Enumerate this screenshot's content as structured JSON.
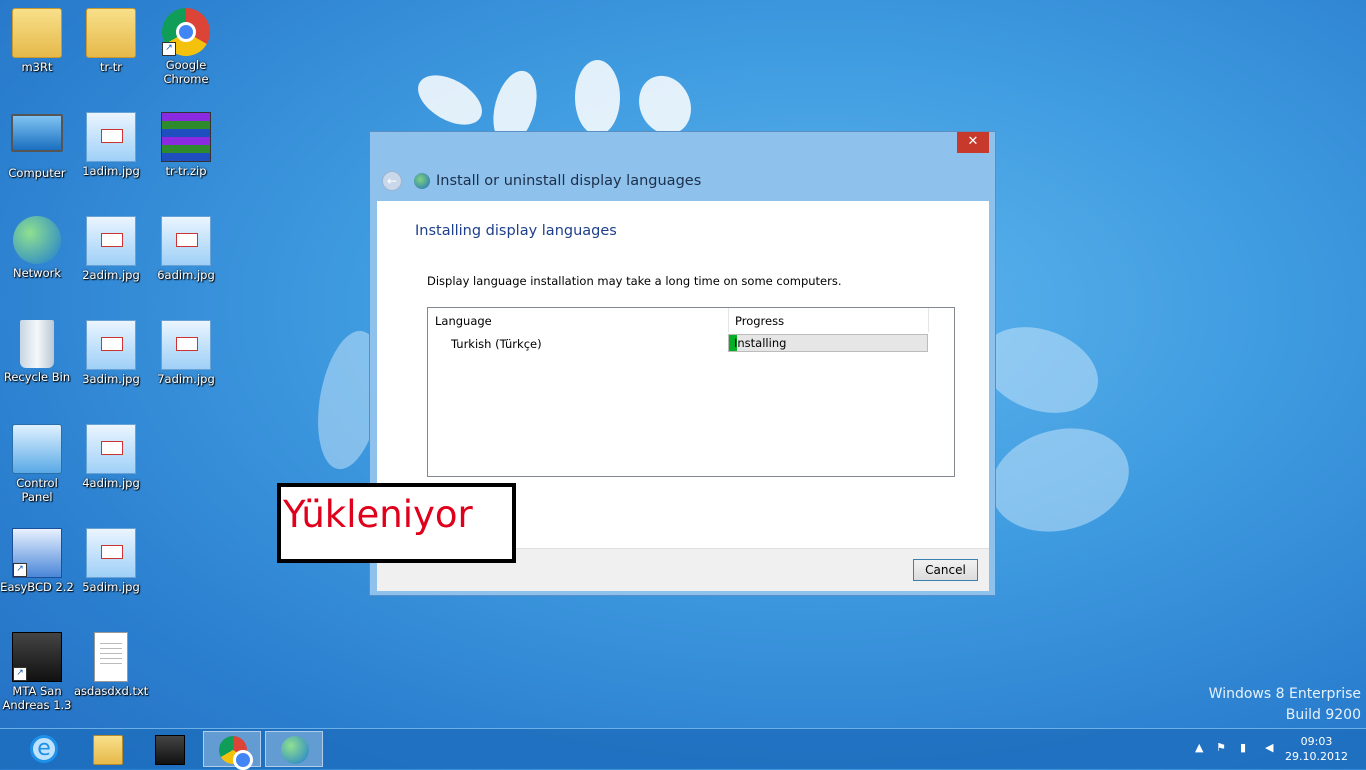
{
  "desktop": {
    "icons": [
      {
        "label": "m3Rt"
      },
      {
        "label": "tr-tr"
      },
      {
        "label": "Google Chrome"
      },
      {
        "label": "Computer"
      },
      {
        "label": "1adim.jpg"
      },
      {
        "label": "tr-tr.zip"
      },
      {
        "label": "Network"
      },
      {
        "label": "2adim.jpg"
      },
      {
        "label": "6adim.jpg"
      },
      {
        "label": "Recycle Bin"
      },
      {
        "label": "3adim.jpg"
      },
      {
        "label": "7adim.jpg"
      },
      {
        "label": "Control Panel"
      },
      {
        "label": "4adim.jpg"
      },
      {
        "label": "EasyBCD 2.2"
      },
      {
        "label": "5adim.jpg"
      },
      {
        "label": "MTA San Andreas 1.3"
      },
      {
        "label": "asdasdxd.txt"
      }
    ],
    "watermark": {
      "line1": "Windows 8 Enterprise",
      "line2": "Build 9200"
    }
  },
  "dialog": {
    "title": "Install or uninstall display languages",
    "close_glyph": "✕",
    "back_glyph": "←",
    "heading": "Installing display languages",
    "info": "Display language installation may take a long time on some computers.",
    "columns": {
      "language": "Language",
      "progress": "Progress"
    },
    "rows": [
      {
        "language": "Turkish (Türkçe)",
        "status": "Installing",
        "progress": 0.04
      }
    ],
    "cancel_label": "Cancel"
  },
  "annotation": {
    "text": "Yükleniyor",
    "color": "#e0001b"
  },
  "taskbar": {
    "apps": [
      "internet-explorer",
      "file-explorer",
      "mta-san-andreas",
      "google-chrome",
      "language-settings"
    ],
    "clock": {
      "time": "09:03",
      "date": "29.10.2012"
    }
  },
  "colors": {
    "accent": "#1e3f8a",
    "progress_fill": "#06b025",
    "close_button": "#c7392b"
  }
}
